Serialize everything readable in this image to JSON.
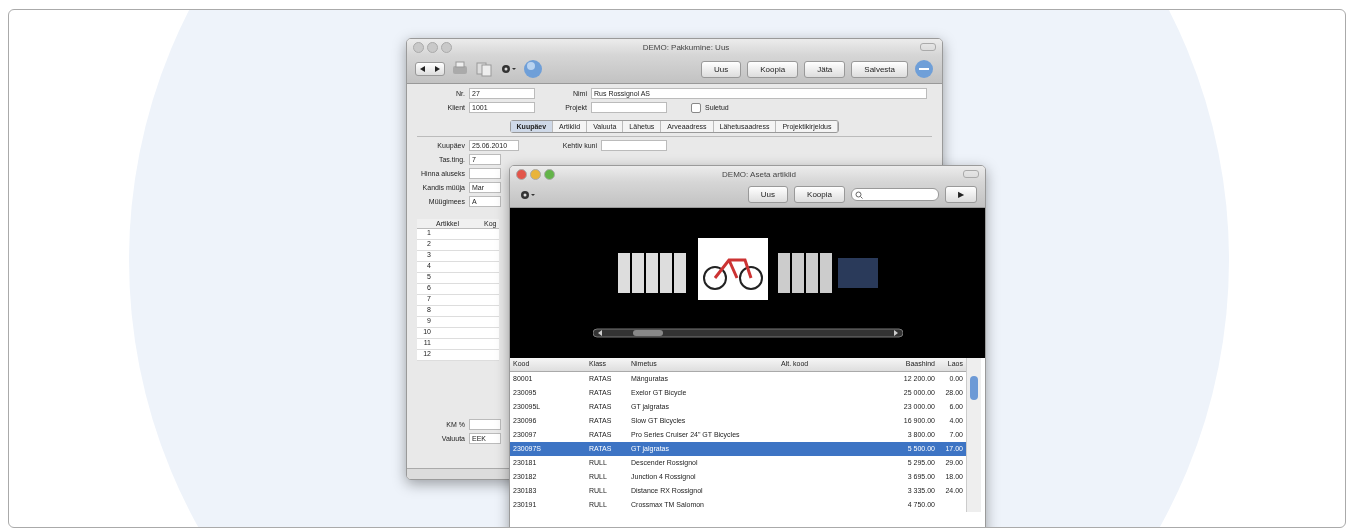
{
  "back_window": {
    "title": "DEMO: Pakkumine: Uus",
    "toolbar_buttons": [
      "Uus",
      "Koopia",
      "Jäta",
      "Salvesta"
    ],
    "fields": [
      {
        "label": "Nr.",
        "value": "27"
      },
      {
        "label": "Nimi",
        "value": "Rus Rossignol AS"
      },
      {
        "label": "Klient",
        "value": "1001"
      },
      {
        "label": "Projekt"
      }
    ],
    "checkbox": {
      "label": "Suletud",
      "checked": false
    },
    "tabs": [
      {
        "label": "Kuupäev",
        "selected": true
      },
      {
        "label": "Artiklid",
        "selected": false
      },
      {
        "label": "Valuuta",
        "selected": false
      },
      {
        "label": "Lähetus",
        "selected": false
      },
      {
        "label": "Arveaadress",
        "selected": false
      },
      {
        "label": "Lähetusaadress",
        "selected": false
      },
      {
        "label": "Projektikirjeldus",
        "selected": false
      }
    ],
    "tab_fields": [
      {
        "label": "Kuupäev",
        "value": "25.06.2010"
      },
      {
        "label": "Tas.ting.",
        "value": "7"
      },
      {
        "label": "Hinna aluseks"
      },
      {
        "label": "Kandis müüja",
        "value": "Mar"
      },
      {
        "label": "Müügimees",
        "value": "A"
      }
    ],
    "valid_field": {
      "label": "Kehtiv kuni"
    },
    "table": {
      "columns": [
        "Artikkel",
        "Kog"
      ],
      "rows": [
        "1",
        "2",
        "3",
        "4",
        "5",
        "6",
        "7",
        "8",
        "9",
        "10",
        "11",
        "12"
      ]
    },
    "footer_fields": [
      {
        "label": "KM %"
      },
      {
        "label": "Valuuta",
        "value": "EEK"
      }
    ]
  },
  "front_window": {
    "title": "DEMO: Aseta artiklid",
    "buttons": [
      "Uus",
      "Koopia"
    ],
    "play_button": "▶",
    "table": {
      "columns": [
        "Kood",
        "Klass",
        "Nimetus",
        "Alt. kood",
        "Baashind",
        "Laos"
      ],
      "rows": [
        {
          "cells": [
            "80001",
            "RATAS",
            "Mänguratas",
            "",
            "12 200.00",
            "0.00"
          ],
          "selected": false
        },
        {
          "cells": [
            "230095",
            "RATAS",
            "Exelor GT Bicycle",
            "",
            "25 000.00",
            "28.00"
          ],
          "selected": false
        },
        {
          "cells": [
            "230095L",
            "RATAS",
            "GT jalgratas",
            "",
            "23 000.00",
            "6.00"
          ],
          "selected": false
        },
        {
          "cells": [
            "230096",
            "RATAS",
            "Slow GT Bicycles",
            "",
            "16 900.00",
            "4.00"
          ],
          "selected": false
        },
        {
          "cells": [
            "230097",
            "RATAS",
            "Pro Series Cruiser 24\"  GT Bicycles",
            "",
            "3 800.00",
            "7.00"
          ],
          "selected": false
        },
        {
          "cells": [
            "230097S",
            "RATAS",
            "GT jalgratas",
            "",
            "5 500.00",
            "17.00"
          ],
          "selected": true
        },
        {
          "cells": [
            "230181",
            "RULL",
            "Descender Rossignol",
            "",
            "5 295.00",
            "29.00"
          ],
          "selected": false
        },
        {
          "cells": [
            "230182",
            "RULL",
            "Junction 4 Rossignol",
            "",
            "3 695.00",
            "18.00"
          ],
          "selected": false
        },
        {
          "cells": [
            "230183",
            "RULL",
            "Distance RX Rossignol",
            "",
            "3 335.00",
            "24.00"
          ],
          "selected": false
        },
        {
          "cells": [
            "230191",
            "RULL",
            "Crossmax TM Salomon",
            "",
            "4 750.00",
            ""
          ],
          "selected": false
        }
      ]
    }
  }
}
